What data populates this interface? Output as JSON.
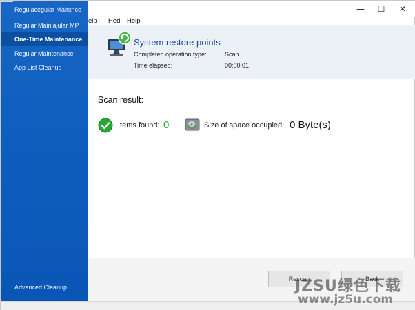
{
  "sidebar": {
    "items": [
      {
        "label": "Regulacegular Maintnce"
      },
      {
        "label": "Regular Mainlaɉular MP"
      },
      {
        "label": "One-Time Maintenance"
      },
      {
        "label": "Regular Maintenance"
      },
      {
        "label": "App List Cleanup"
      },
      {
        "label": "Advanced Cleanup"
      }
    ],
    "active_item": "One-Time Maintenance"
  },
  "window_controls": {
    "minimize": "—",
    "maximize": "☐",
    "close": "✕"
  },
  "menu": {
    "items": [
      "elp",
      "Hed",
      "Help"
    ]
  },
  "header": {
    "title": "System restore points",
    "rows": [
      {
        "label": "Completed operation type:",
        "value": "Scan"
      },
      {
        "label": "Time elapsed:",
        "value": "00:00:01"
      }
    ]
  },
  "scan": {
    "title": "Scan result:",
    "items_found_label": "Items found:",
    "items_found_value": "0",
    "size_label": "Size of space occupied:",
    "size_value": "0 Byte(s)"
  },
  "buttons": {
    "rescan": "Rescan",
    "back": "Back"
  },
  "watermark": {
    "line1": "JZSU绿色下载",
    "line2": "www.jz5u.com"
  },
  "colors": {
    "sidebar": "#0f5fc0",
    "header_bg": "#ebf1f7",
    "title": "#1a4f98",
    "success": "#2aa637"
  }
}
